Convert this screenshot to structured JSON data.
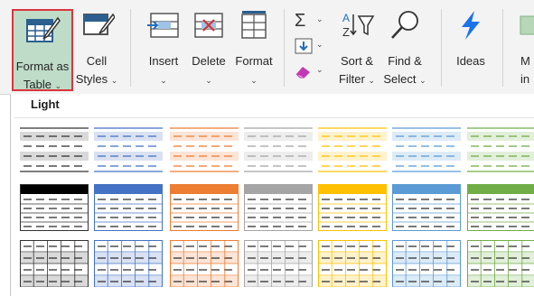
{
  "ribbon": {
    "format_as_table": {
      "line1": "Format as",
      "line2": "Table"
    },
    "cell_styles": {
      "line1": "Cell",
      "line2": "Styles"
    },
    "insert": {
      "label": "Insert"
    },
    "delete": {
      "label": "Delete"
    },
    "format": {
      "label": "Format"
    },
    "sort_filter": {
      "line1": "Sort &",
      "line2": "Filter"
    },
    "find_select": {
      "line1": "Find &",
      "line2": "Select"
    },
    "ideas": {
      "label": "Ideas"
    },
    "partial": {
      "line1": "M",
      "line2": "in"
    },
    "dropdown_caret": "⌄"
  },
  "gallery": {
    "section_label": "Light",
    "accent_colors": [
      "#000000",
      "#4472c4",
      "#ed7d31",
      "#a5a5a5",
      "#ffc000",
      "#5b9bd5",
      "#70ad47"
    ],
    "light_row1_band_colors": [
      "#d9d9d9",
      "#d9e1f2",
      "#fce4d6",
      "#ededed",
      "#fff2cc",
      "#ddebf7",
      "#e2efda"
    ]
  },
  "colors": {
    "selected_fill": "#bedcc7",
    "selected_border": "#d9363e",
    "ideas_bolt": "#1a73e8"
  }
}
